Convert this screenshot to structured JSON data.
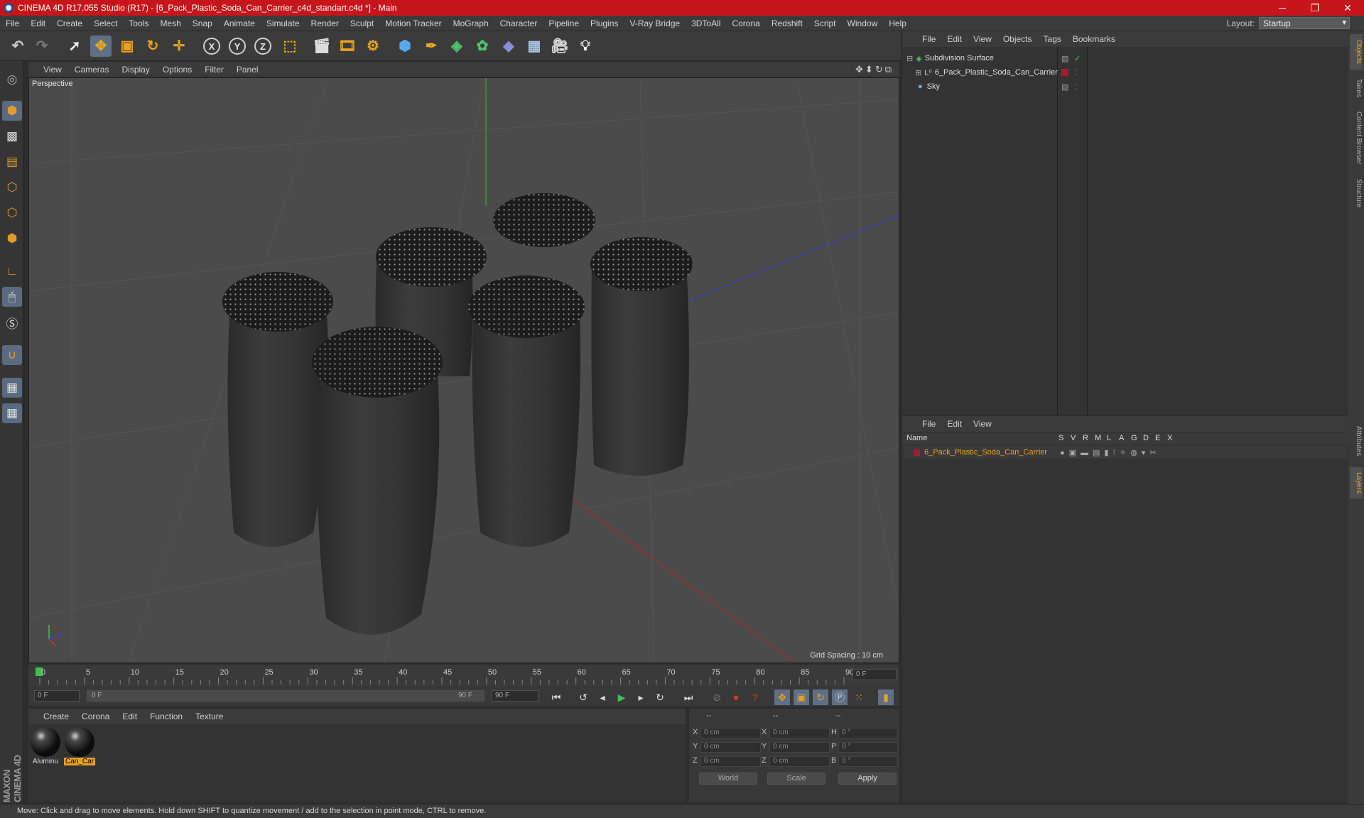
{
  "titlebar": {
    "title": "CINEMA 4D R17.055 Studio (R17) - [6_Pack_Plastic_Soda_Can_Carrier_c4d_standart.c4d *] - Main"
  },
  "menubar": {
    "items": [
      "File",
      "Edit",
      "Create",
      "Select",
      "Tools",
      "Mesh",
      "Snap",
      "Animate",
      "Simulate",
      "Render",
      "Sculpt",
      "Motion Tracker",
      "MoGraph",
      "Character",
      "Pipeline",
      "Plugins",
      "V-Ray Bridge",
      "3DToAll",
      "Corona",
      "Redshift",
      "Script",
      "Window",
      "Help"
    ]
  },
  "layout": {
    "label": "Layout:",
    "value": "Startup"
  },
  "toolbar": {
    "x": "X",
    "y": "Y",
    "z": "Z"
  },
  "viewport": {
    "menu": [
      "View",
      "Cameras",
      "Display",
      "Options",
      "Filter",
      "Panel"
    ],
    "label": "Perspective",
    "grid_spacing": "Grid Spacing : 10 cm"
  },
  "timeline": {
    "ticks": [
      "0",
      "5",
      "10",
      "15",
      "20",
      "25",
      "30",
      "35",
      "40",
      "45",
      "50",
      "55",
      "60",
      "65",
      "70",
      "75",
      "80",
      "85",
      "90"
    ],
    "current_frame": "0 F"
  },
  "playbar": {
    "start": "0 F",
    "range_start": "0 F",
    "range_end": "90 F",
    "end": "90 F"
  },
  "materials": {
    "menu": [
      "Create",
      "Corona",
      "Edit",
      "Function",
      "Texture"
    ],
    "items": [
      {
        "name": "Aluminu",
        "selected": false
      },
      {
        "name": "Can_Car",
        "selected": true
      }
    ]
  },
  "coords": {
    "headers": [
      "--",
      "--",
      "--"
    ],
    "rows": [
      {
        "l1": "X",
        "v1": "0 cm",
        "l2": "X",
        "v2": "0 cm",
        "l3": "H",
        "v3": "0 °"
      },
      {
        "l1": "Y",
        "v1": "0 cm",
        "l2": "Y",
        "v2": "0 cm",
        "l3": "P",
        "v3": "0 °"
      },
      {
        "l1": "Z",
        "v1": "0 cm",
        "l2": "Z",
        "v2": "0 cm",
        "l3": "B",
        "v3": "0 °"
      }
    ],
    "world": "World",
    "scale": "Scale",
    "apply": "Apply"
  },
  "objects": {
    "menu": [
      "File",
      "Edit",
      "View",
      "Objects",
      "Tags",
      "Bookmarks"
    ],
    "items": [
      {
        "name": "Subdivision Surface"
      },
      {
        "name": "6_Pack_Plastic_Soda_Can_Carrier"
      },
      {
        "name": "Sky"
      }
    ]
  },
  "layers": {
    "menu": [
      "File",
      "Edit",
      "View"
    ],
    "name_col": "Name",
    "cols": [
      "S",
      "V",
      "R",
      "M",
      "L",
      "A",
      "G",
      "D",
      "E",
      "X"
    ],
    "items": [
      {
        "name": "6_Pack_Plastic_Soda_Can_Carrier"
      }
    ]
  },
  "right_tabs": [
    "Objects",
    "Takes",
    "Content Browser",
    "Structure",
    "Attributes",
    "Layers"
  ],
  "statusbar": {
    "text": "Move: Click and drag to move elements. Hold down SHIFT to quantize movement / add to the selection in point mode, CTRL to remove."
  },
  "branding": {
    "maxon": "MAXON CINEMA 4D"
  },
  "colors": {
    "accent": "#e8a320",
    "titlebar": "#c7161b",
    "selection": "#5f6f85"
  }
}
